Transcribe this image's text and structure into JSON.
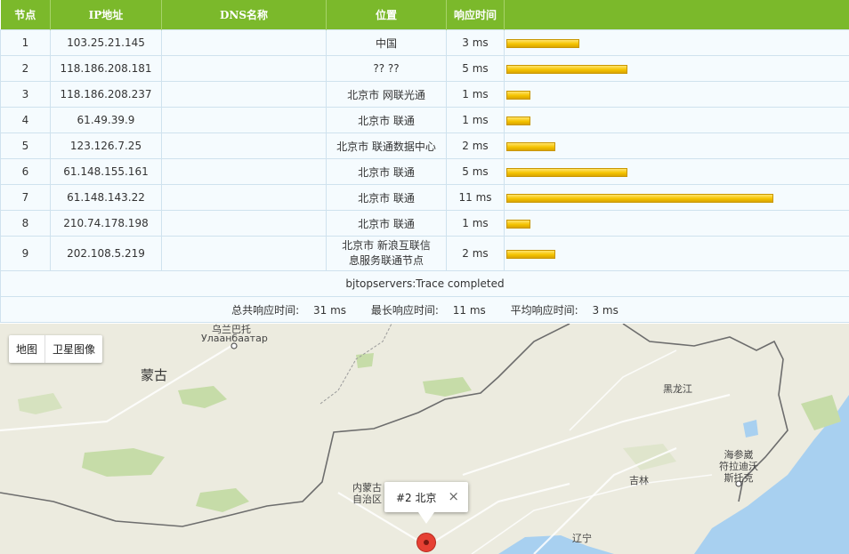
{
  "table": {
    "headers": [
      "节点",
      "IP地址",
      "DNS名称",
      "位置",
      "响应时间",
      ""
    ],
    "rows": [
      {
        "hop": "1",
        "ip": "103.25.21.145",
        "dns": "",
        "location": "中国",
        "time": "3 ms",
        "ms": 3
      },
      {
        "hop": "2",
        "ip": "118.186.208.181",
        "dns": "",
        "location": "?? ??",
        "time": "5 ms",
        "ms": 5
      },
      {
        "hop": "3",
        "ip": "118.186.208.237",
        "dns": "",
        "location": "北京市 网联光通",
        "time": "1 ms",
        "ms": 1
      },
      {
        "hop": "4",
        "ip": "61.49.39.9",
        "dns": "",
        "location": "北京市 联通",
        "time": "1 ms",
        "ms": 1
      },
      {
        "hop": "5",
        "ip": "123.126.7.25",
        "dns": "",
        "location": "北京市 联通数据中心",
        "time": "2 ms",
        "ms": 2
      },
      {
        "hop": "6",
        "ip": "61.148.155.161",
        "dns": "",
        "location": "北京市 联通",
        "time": "5 ms",
        "ms": 5
      },
      {
        "hop": "7",
        "ip": "61.148.143.22",
        "dns": "",
        "location": "北京市 联通",
        "time": "11 ms",
        "ms": 11
      },
      {
        "hop": "8",
        "ip": "210.74.178.198",
        "dns": "",
        "location": "北京市 联通",
        "time": "1 ms",
        "ms": 1
      },
      {
        "hop": "9",
        "ip": "202.108.5.219",
        "dns": "",
        "location": "北京市 新浪互联信息服务联通节点",
        "time": "2 ms",
        "ms": 2
      }
    ],
    "completed": "bjtopservers:Trace completed",
    "summary": {
      "total_label": "总共响应时间:",
      "total": "31 ms",
      "max_label": "最长响应时间:",
      "max": "11 ms",
      "avg_label": "平均响应时间:",
      "avg": "3 ms"
    }
  },
  "map": {
    "controls": {
      "map": "地图",
      "satellite": "卫星图像"
    },
    "labels": {
      "ulaanbaatar_cn": "乌兰巴托",
      "ulaanbaatar": "Улаанбаатар",
      "mongolia": "蒙古",
      "heilongjiang": "黑龙江",
      "vladivostok": "海参崴\n符拉迪沃\n斯托克",
      "jilin": "吉林",
      "inner_mongolia": "内蒙古\n自治区",
      "liaoning": "辽宁"
    },
    "popup": {
      "text": "#2 北京",
      "close": "×"
    }
  }
}
